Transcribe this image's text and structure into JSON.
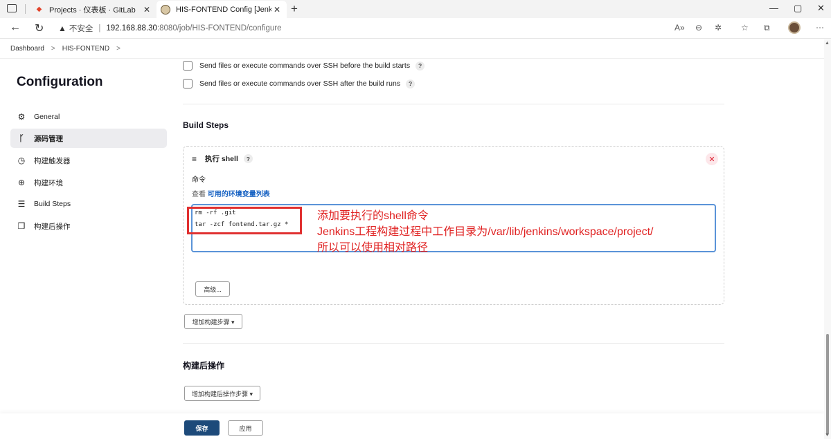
{
  "browser": {
    "tabs": [
      {
        "title": "Projects · 仪表板 · GitLab",
        "active": false
      },
      {
        "title": "HIS-FONTEND Config [Jenkins]",
        "active": true
      }
    ],
    "security_label": "不安全",
    "url_host": "192.168.88.30",
    "url_path": ":8080/job/HIS-FONTEND/configure"
  },
  "breadcrumbs": [
    "Dashboard",
    "HIS-FONTEND"
  ],
  "sidebar": {
    "title": "Configuration",
    "items": [
      {
        "label": "General",
        "icon": "gear-icon"
      },
      {
        "label": "源码管理",
        "icon": "branch-icon"
      },
      {
        "label": "构建触发器",
        "icon": "clock-icon"
      },
      {
        "label": "构建环境",
        "icon": "globe-icon"
      },
      {
        "label": "Build Steps",
        "icon": "list-icon"
      },
      {
        "label": "构建后操作",
        "icon": "cube-icon"
      }
    ]
  },
  "main": {
    "ssh_before": "Send files or execute commands over SSH before the build starts",
    "ssh_after": "Send files or execute commands over SSH after the build runs",
    "build_steps_title": "Build Steps",
    "step": {
      "title": "执行 shell",
      "command_label": "命令",
      "env_prefix": "查看 ",
      "env_link": "可用的环境变量列表",
      "code_lines": [
        "rm -rf .git",
        "tar -zcf fontend.tar.gz *"
      ],
      "advanced_button": "高级..."
    },
    "add_build_step_button": "增加构建步骤 ▾",
    "post_build_title": "构建后操作",
    "add_post_build_button": "增加构建后操作步骤 ▾"
  },
  "annotation": {
    "line1": "添加要执行的shell命令",
    "line2": "Jenkins工程构建过程中工作目录为/var/lib/jenkins/workspace/project/",
    "line3": "所以可以使用相对路径"
  },
  "footer": {
    "save": "保存",
    "apply": "应用"
  },
  "help_mark": "?",
  "colors": {
    "primary_button": "#1d4a7a",
    "annotation_red": "#e02222",
    "link_blue": "#1460c2"
  }
}
